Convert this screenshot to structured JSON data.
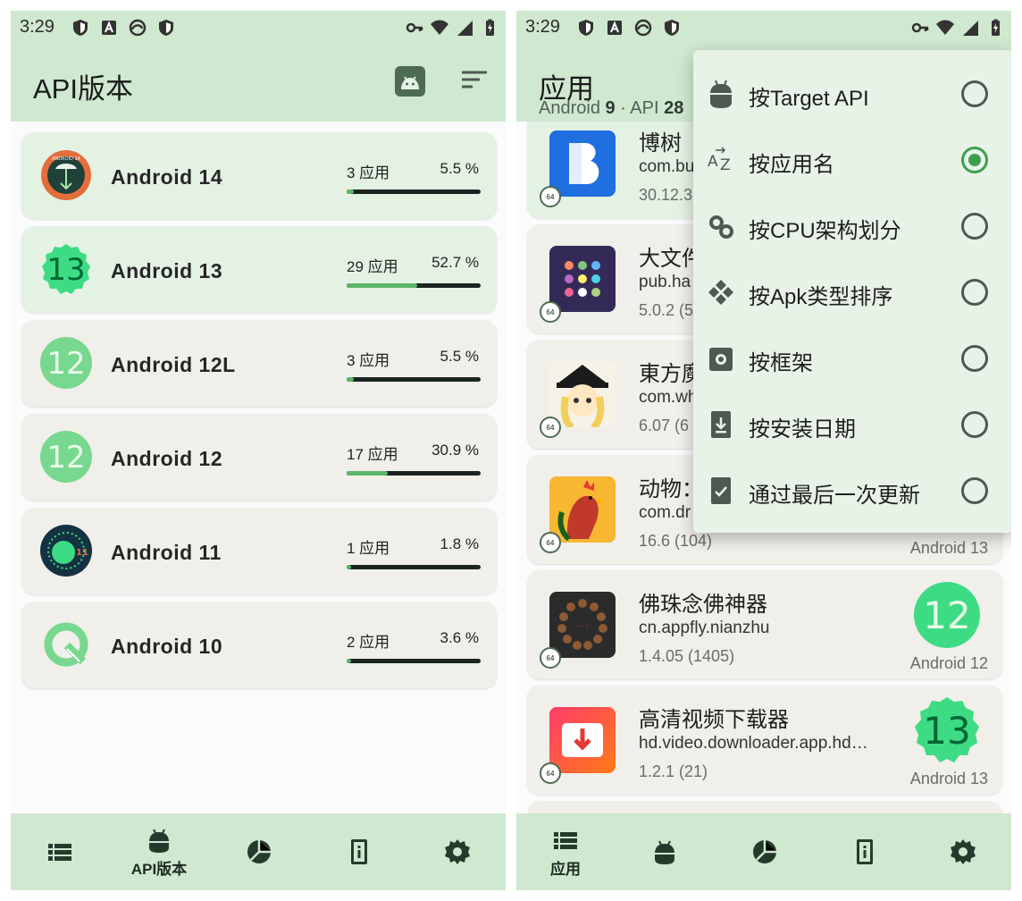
{
  "status": {
    "time": "3:29"
  },
  "left": {
    "title": "API版本",
    "api_versions": [
      {
        "name": "Android 14",
        "count": "3 应用",
        "percent": "5.5 %",
        "fraction": 0.055,
        "badge_text": "ANDROID 14"
      },
      {
        "name": "Android 13",
        "count": "29 应用",
        "percent": "52.7 %",
        "fraction": 0.527,
        "badge_text": "13"
      },
      {
        "name": "Android 12L",
        "count": "3 应用",
        "percent": "5.5 %",
        "fraction": 0.055,
        "badge_text": "12"
      },
      {
        "name": "Android 12",
        "count": "17 应用",
        "percent": "30.9 %",
        "fraction": 0.309,
        "badge_text": "12"
      },
      {
        "name": "Android 11",
        "count": "1 应用",
        "percent": "1.8 %",
        "fraction": 0.018,
        "badge_text": "11"
      },
      {
        "name": "Android 10",
        "count": "2 应用",
        "percent": "3.6 %",
        "fraction": 0.036,
        "badge_text": ""
      }
    ],
    "nav": {
      "active_label": "API版本"
    }
  },
  "right": {
    "title": "应用",
    "subtitle": {
      "prefix": "Android ",
      "version": "9",
      "sep": " · API ",
      "api": "28"
    },
    "apps": [
      {
        "name": "博树",
        "package": "com.bu",
        "version": "30.12.3",
        "cpu_badge": "64",
        "api_badge_text": "",
        "api_label": ""
      },
      {
        "name": "大文件",
        "package": "pub.ha",
        "version": "5.0.2 (5",
        "cpu_badge": "64",
        "api_badge_text": "",
        "api_label": ""
      },
      {
        "name": "東方魔",
        "package": "com.wh",
        "version": "6.07 (6",
        "cpu_badge": "64",
        "api_badge_text": "",
        "api_label": ""
      },
      {
        "name": "动物：",
        "package": "com.dr",
        "version": "16.6 (104)",
        "cpu_badge": "64",
        "api_badge_text": "",
        "api_label": "Android 13"
      },
      {
        "name": "佛珠念佛神器",
        "package": "cn.appfly.nianzhu",
        "version": "1.4.05 (1405)",
        "cpu_badge": "64",
        "api_badge_text": "12",
        "api_label": "Android 12"
      },
      {
        "name": "高清视频下载器",
        "package": "hd.video.downloader.app.hd…",
        "version": "1.2.1 (21)",
        "cpu_badge": "64",
        "api_badge_text": "13",
        "api_label": "Android 13"
      }
    ],
    "sort_menu": [
      {
        "label": "按Target API",
        "selected": false,
        "icon": "android-icon"
      },
      {
        "label": "按应用名",
        "selected": true,
        "icon": "az-sort-icon"
      },
      {
        "label": "按CPU架构划分",
        "selected": false,
        "icon": "cpu-icon"
      },
      {
        "label": "按Apk类型排序",
        "selected": false,
        "icon": "apk-type-icon"
      },
      {
        "label": "按框架",
        "selected": false,
        "icon": "framework-icon"
      },
      {
        "label": "按安装日期",
        "selected": false,
        "icon": "install-date-icon"
      },
      {
        "label": "通过最后一次更新",
        "selected": false,
        "icon": "last-update-icon"
      }
    ],
    "nav": {
      "active_label": "应用"
    }
  },
  "colors": {
    "bar_green": "#cfe8cf",
    "card_green": "#e4f2e4",
    "card_grey": "#f1efea",
    "accent_green": "#3f9d4f",
    "progress_fill": "#5db56a",
    "icon_dark": "#4d6b52"
  }
}
